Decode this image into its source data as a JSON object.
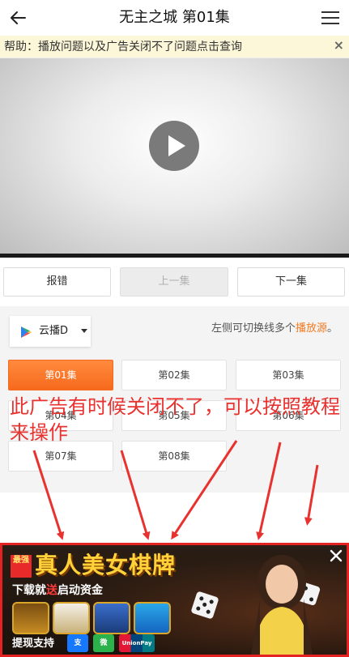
{
  "header": {
    "title": "无主之城 第01集"
  },
  "help_bar": {
    "text": "帮助：播放问题以及广告关闭不了问题点击查询",
    "close_label": "×"
  },
  "controls": {
    "report_label": "报错",
    "prev_label": "上一集",
    "next_label": "下一集"
  },
  "source": {
    "label": "云播D",
    "hint_prefix": "左侧可切换线多个",
    "hint_highlight": "播放源",
    "hint_suffix": "。"
  },
  "episodes": [
    {
      "label": "第01集",
      "active": true
    },
    {
      "label": "第02集",
      "active": false
    },
    {
      "label": "第03集",
      "active": false
    },
    {
      "label": "第04集",
      "active": false
    },
    {
      "label": "第05集",
      "active": false
    },
    {
      "label": "第06集",
      "active": false
    },
    {
      "label": "第07集",
      "active": false
    },
    {
      "label": "第08集",
      "active": false
    }
  ],
  "annotation": {
    "text": "此广告有时候关闭不了，可以按照教程来操作"
  },
  "ad": {
    "badge": "最强",
    "title": "真人美女棋牌",
    "sub_prefix": "下载就",
    "sub_highlight": "送",
    "sub_suffix": "启动资金",
    "pay_label": "提现支持",
    "pay_unionpay": "UnionPay 银联"
  },
  "colors": {
    "accent_orange": "#f66a1d",
    "annotation_red": "#e8322f",
    "help_bg": "#fdf7d9"
  }
}
